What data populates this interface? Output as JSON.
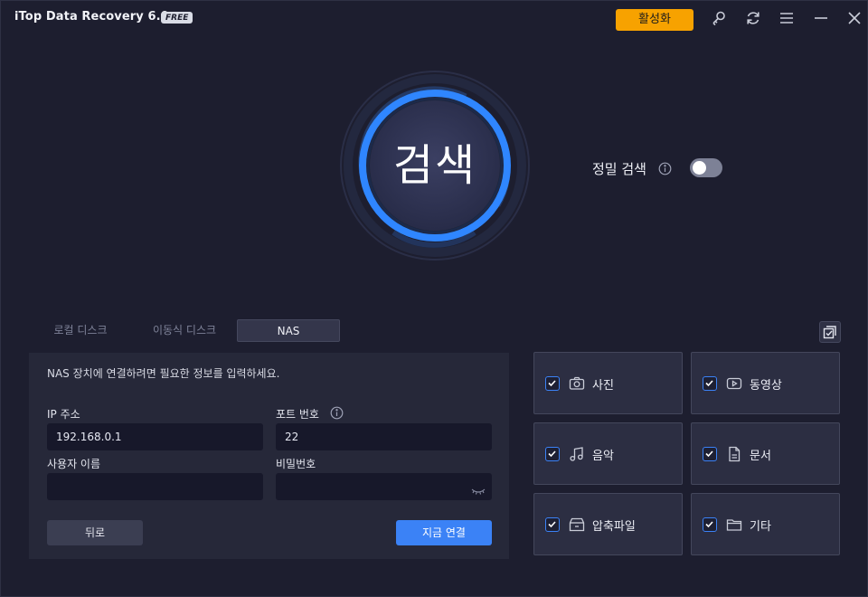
{
  "app": {
    "title": "iTop Data Recovery 6.0",
    "badge": "FREE"
  },
  "titlebar": {
    "activate_label": "활성화",
    "icons": [
      "key-icon",
      "refresh-icon",
      "menu-icon",
      "minimize-icon",
      "close-icon"
    ]
  },
  "scan": {
    "label": "검색",
    "accent": "#2f86ff"
  },
  "deep_scan": {
    "label": "정밀 검색",
    "enabled": false
  },
  "tabs": [
    {
      "label": "로컬 디스크",
      "active": false
    },
    {
      "label": "이동식 디스크",
      "active": false
    },
    {
      "label": "NAS",
      "active": true
    }
  ],
  "nas": {
    "hint": "NAS 장치에 연결하려면 필요한 정보를 입력하세요.",
    "ip_label": "IP 주소",
    "ip_value": "192.168.0.1",
    "port_label": "포트 번호",
    "port_value": "22",
    "user_label": "사용자 이름",
    "user_value": "",
    "password_label": "비밀번호",
    "password_value": "",
    "back_label": "뒤로",
    "connect_label": "지금 연결"
  },
  "file_types": [
    {
      "label": "사진",
      "icon": "camera-icon",
      "checked": true
    },
    {
      "label": "동영상",
      "icon": "video-icon",
      "checked": true
    },
    {
      "label": "음악",
      "icon": "music-icon",
      "checked": true
    },
    {
      "label": "문서",
      "icon": "document-icon",
      "checked": true
    },
    {
      "label": "압축파일",
      "icon": "archive-icon",
      "checked": true
    },
    {
      "label": "기타",
      "icon": "folder-icon",
      "checked": true
    }
  ],
  "colors": {
    "accent": "#3b82f6",
    "activate": "#f7a200",
    "background": "#1d1e2f"
  }
}
